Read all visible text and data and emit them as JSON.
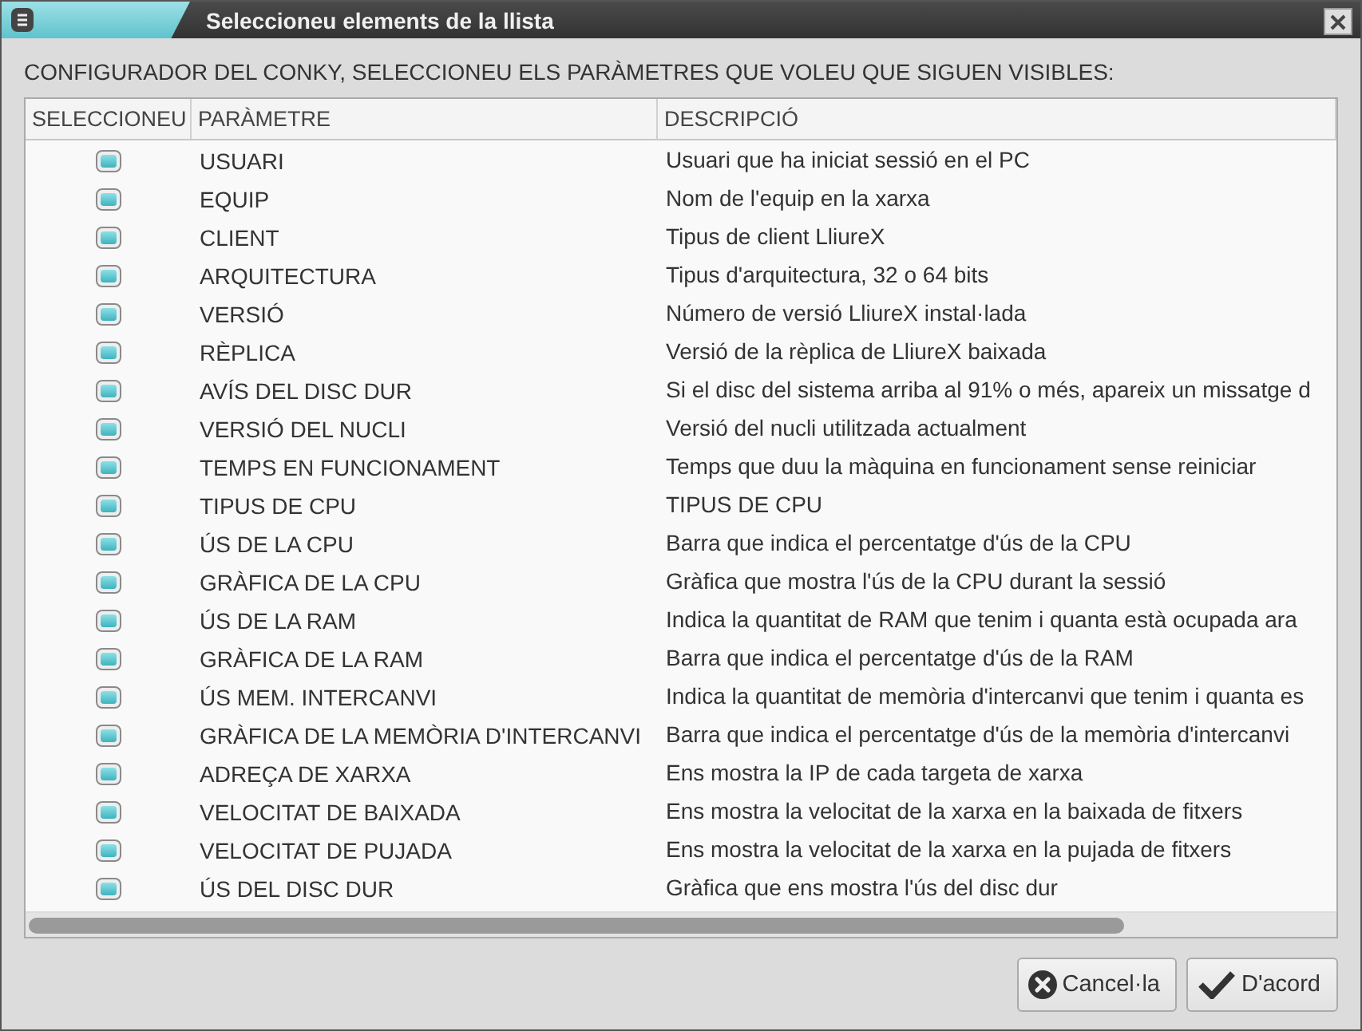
{
  "window": {
    "title": "Seleccioneu elements de la llista"
  },
  "prompt": "CONFIGURADOR DEL CONKY, SELECCIONEU ELS PARÀMETRES QUE VOLEU QUE SIGUEN VISIBLES:",
  "table": {
    "columns": [
      "SELECCIONEU",
      "PARÀMETRE",
      "DESCRIPCIÓ"
    ],
    "rows": [
      {
        "checked": true,
        "parameter": "USUARI",
        "description": "Usuari que ha iniciat sessió en el PC"
      },
      {
        "checked": true,
        "parameter": "EQUIP",
        "description": "Nom de l'equip en la xarxa"
      },
      {
        "checked": true,
        "parameter": "CLIENT",
        "description": "Tipus de client LliureX"
      },
      {
        "checked": true,
        "parameter": "ARQUITECTURA",
        "description": "Tipus d'arquitectura, 32 o 64 bits"
      },
      {
        "checked": true,
        "parameter": "VERSIÓ",
        "description": "Número de versió LliureX instal·lada"
      },
      {
        "checked": true,
        "parameter": "RÈPLICA",
        "description": "Versió de la rèplica de LliureX baixada"
      },
      {
        "checked": true,
        "parameter": "AVÍS DEL DISC DUR",
        "description": "Si el disc del sistema arriba al 91% o més, apareix un missatge d"
      },
      {
        "checked": true,
        "parameter": "VERSIÓ DEL NUCLI",
        "description": "Versió del nucli utilitzada actualment"
      },
      {
        "checked": true,
        "parameter": "TEMPS EN FUNCIONAMENT",
        "description": "Temps que duu la màquina en funcionament sense reiniciar"
      },
      {
        "checked": true,
        "parameter": "TIPUS DE CPU",
        "description": "TIPUS DE CPU"
      },
      {
        "checked": true,
        "parameter": "ÚS DE LA CPU",
        "description": "Barra que indica el percentatge d'ús de la CPU"
      },
      {
        "checked": true,
        "parameter": "GRÀFICA DE LA CPU",
        "description": "Gràfica que mostra l'ús de la CPU durant la sessió"
      },
      {
        "checked": true,
        "parameter": "ÚS DE LA RAM",
        "description": "Indica la quantitat de RAM que tenim i quanta està ocupada ara"
      },
      {
        "checked": true,
        "parameter": "GRÀFICA DE LA RAM",
        "description": "Barra que indica el percentatge d'ús de la RAM"
      },
      {
        "checked": true,
        "parameter": "ÚS MEM. INTERCANVI",
        "description": "Indica la quantitat de memòria d'intercanvi que tenim i quanta es"
      },
      {
        "checked": true,
        "parameter": "GRÀFICA DE LA MEMÒRIA D'INTERCANVI",
        "description": "Barra que indica el percentatge d'ús de la memòria d'intercanvi"
      },
      {
        "checked": true,
        "parameter": "ADREÇA DE XARXA",
        "description": "Ens mostra la IP de cada targeta de xarxa"
      },
      {
        "checked": true,
        "parameter": "VELOCITAT DE BAIXADA",
        "description": "Ens mostra la velocitat de la xarxa en la baixada de fitxers"
      },
      {
        "checked": true,
        "parameter": "VELOCITAT DE PUJADA",
        "description": "Ens mostra la velocitat de la xarxa en la pujada de fitxers"
      },
      {
        "checked": true,
        "parameter": "ÚS DEL DISC DUR",
        "description": "Gràfica que ens mostra l'ús del disc dur"
      }
    ]
  },
  "buttons": [
    {
      "kind": "cancel",
      "label": "Cancel·la"
    },
    {
      "kind": "ok",
      "label": "D'acord"
    }
  ]
}
